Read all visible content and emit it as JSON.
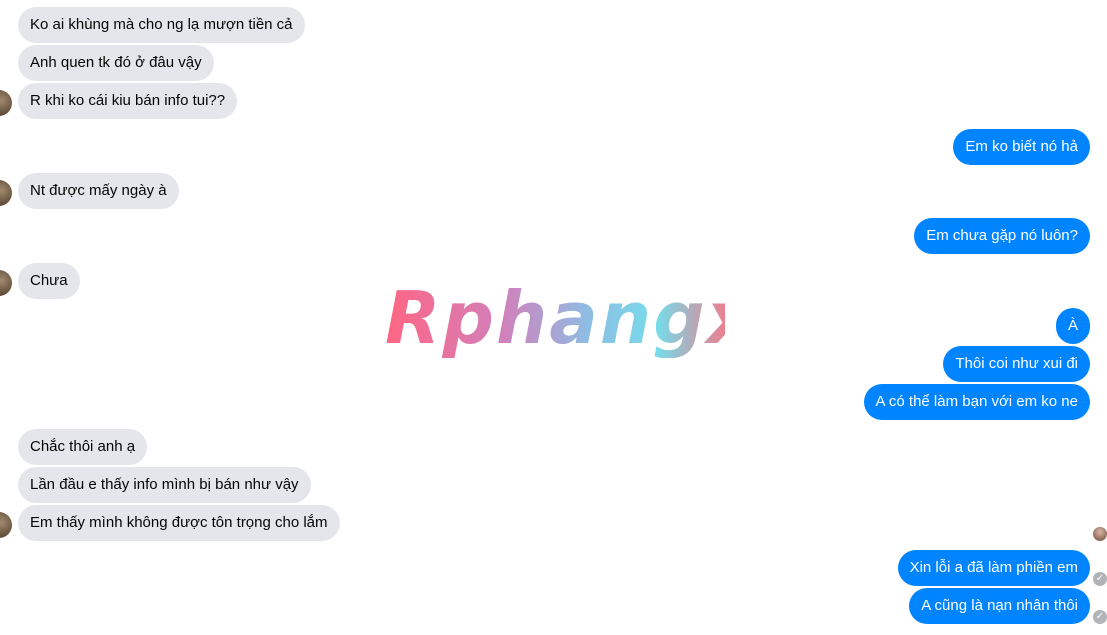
{
  "messages": {
    "m1": "Ko ai khùng mà cho ng lạ mượn tiền cả",
    "m2": "Anh quen tk đó ở đâu vậy",
    "m3": "R khi ko cái kiu bán info tui??",
    "m4": "Em ko biết nó hả",
    "m5": "Nt được mấy ngày à",
    "m6": "Em chưa gặp nó luôn?",
    "m7": "Chưa",
    "m8": "À",
    "m9": "Thôi coi như xui đi",
    "m10": "A có thể làm bạn với em ko ne",
    "m11": "Chắc thôi anh ạ",
    "m12": "Lần đầu e thấy info mình bị bán như vậy",
    "m13": "Em thấy mình không được tôn trọng cho lắm",
    "m14": "Xin lỗi a đã làm phiền em",
    "m15": "A cũng là nạn nhân thôi"
  },
  "watermark": {
    "text": "Rphangx"
  },
  "colors": {
    "incoming_bg": "#e4e6eb",
    "outgoing_bg": "#0084ff",
    "read_check": "#b0b3b8"
  },
  "icons": {
    "avatar": "contact-avatar-icon",
    "read": "check-circle-icon",
    "seen": "seen-avatar-icon"
  }
}
